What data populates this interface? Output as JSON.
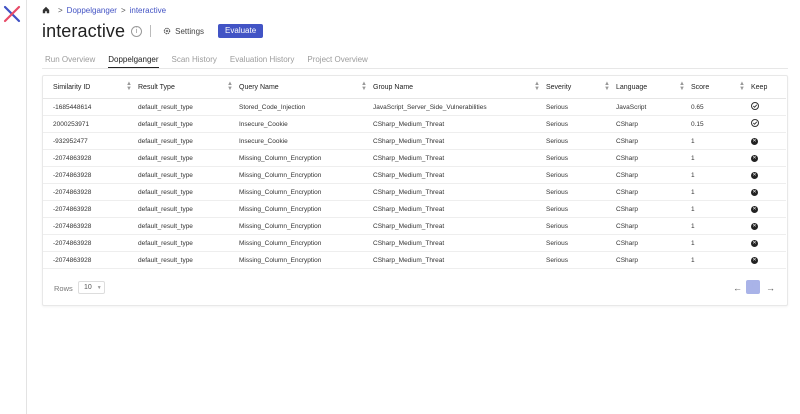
{
  "breadcrumb": {
    "items": [
      "Doppelganger",
      "interactive"
    ],
    "separator": ">"
  },
  "header": {
    "title": "interactive",
    "info_icon": "i",
    "settings_label": "Settings",
    "evaluate_label": "Evaluate"
  },
  "tabs": [
    {
      "label": "Run Overview",
      "active": false
    },
    {
      "label": "Doppelganger",
      "active": true
    },
    {
      "label": "Scan History",
      "active": false
    },
    {
      "label": "Evaluation History",
      "active": false
    },
    {
      "label": "Project Overview",
      "active": false
    }
  ],
  "table": {
    "columns": [
      "Similarity ID",
      "Result Type",
      "Query Name",
      "Group Name",
      "Severity",
      "Language",
      "Score",
      "Keep"
    ],
    "rows": [
      {
        "id": "-1685448614",
        "type": "default_result_type",
        "query": "Stored_Code_Injection",
        "group": "JavaScript_Server_Side_Vulnerabilities",
        "severity": "Serious",
        "language": "JavaScript",
        "score": "0.65",
        "keep": true
      },
      {
        "id": "2000253971",
        "type": "default_result_type",
        "query": "Insecure_Cookie",
        "group": "CSharp_Medium_Threat",
        "severity": "Serious",
        "language": "CSharp",
        "score": "0.15",
        "keep": true
      },
      {
        "id": "-932952477",
        "type": "default_result_type",
        "query": "Insecure_Cookie",
        "group": "CSharp_Medium_Threat",
        "severity": "Serious",
        "language": "CSharp",
        "score": "1",
        "keep": false
      },
      {
        "id": "-2074863928",
        "type": "default_result_type",
        "query": "Missing_Column_Encryption",
        "group": "CSharp_Medium_Threat",
        "severity": "Serious",
        "language": "CSharp",
        "score": "1",
        "keep": false
      },
      {
        "id": "-2074863928",
        "type": "default_result_type",
        "query": "Missing_Column_Encryption",
        "group": "CSharp_Medium_Threat",
        "severity": "Serious",
        "language": "CSharp",
        "score": "1",
        "keep": false
      },
      {
        "id": "-2074863928",
        "type": "default_result_type",
        "query": "Missing_Column_Encryption",
        "group": "CSharp_Medium_Threat",
        "severity": "Serious",
        "language": "CSharp",
        "score": "1",
        "keep": false
      },
      {
        "id": "-2074863928",
        "type": "default_result_type",
        "query": "Missing_Column_Encryption",
        "group": "CSharp_Medium_Threat",
        "severity": "Serious",
        "language": "CSharp",
        "score": "1",
        "keep": false
      },
      {
        "id": "-2074863928",
        "type": "default_result_type",
        "query": "Missing_Column_Encryption",
        "group": "CSharp_Medium_Threat",
        "severity": "Serious",
        "language": "CSharp",
        "score": "1",
        "keep": false
      },
      {
        "id": "-2074863928",
        "type": "default_result_type",
        "query": "Missing_Column_Encryption",
        "group": "CSharp_Medium_Threat",
        "severity": "Serious",
        "language": "CSharp",
        "score": "1",
        "keep": false
      },
      {
        "id": "-2074863928",
        "type": "default_result_type",
        "query": "Missing_Column_Encryption",
        "group": "CSharp_Medium_Threat",
        "severity": "Serious",
        "language": "CSharp",
        "score": "1",
        "keep": false
      }
    ]
  },
  "pagination": {
    "rows_label": "Rows",
    "rows_value": "10",
    "current_page": "1"
  },
  "icons": {
    "home": "home-icon",
    "settings": "gear-icon",
    "keep_true": "check-circle-icon",
    "keep_false": "x-circle-icon"
  },
  "colors": {
    "accent": "#4254c5",
    "link": "#4353c4",
    "page_active": "#a9b3e8",
    "logo_blue": "#3f51c4",
    "logo_red": "#e74b68"
  }
}
